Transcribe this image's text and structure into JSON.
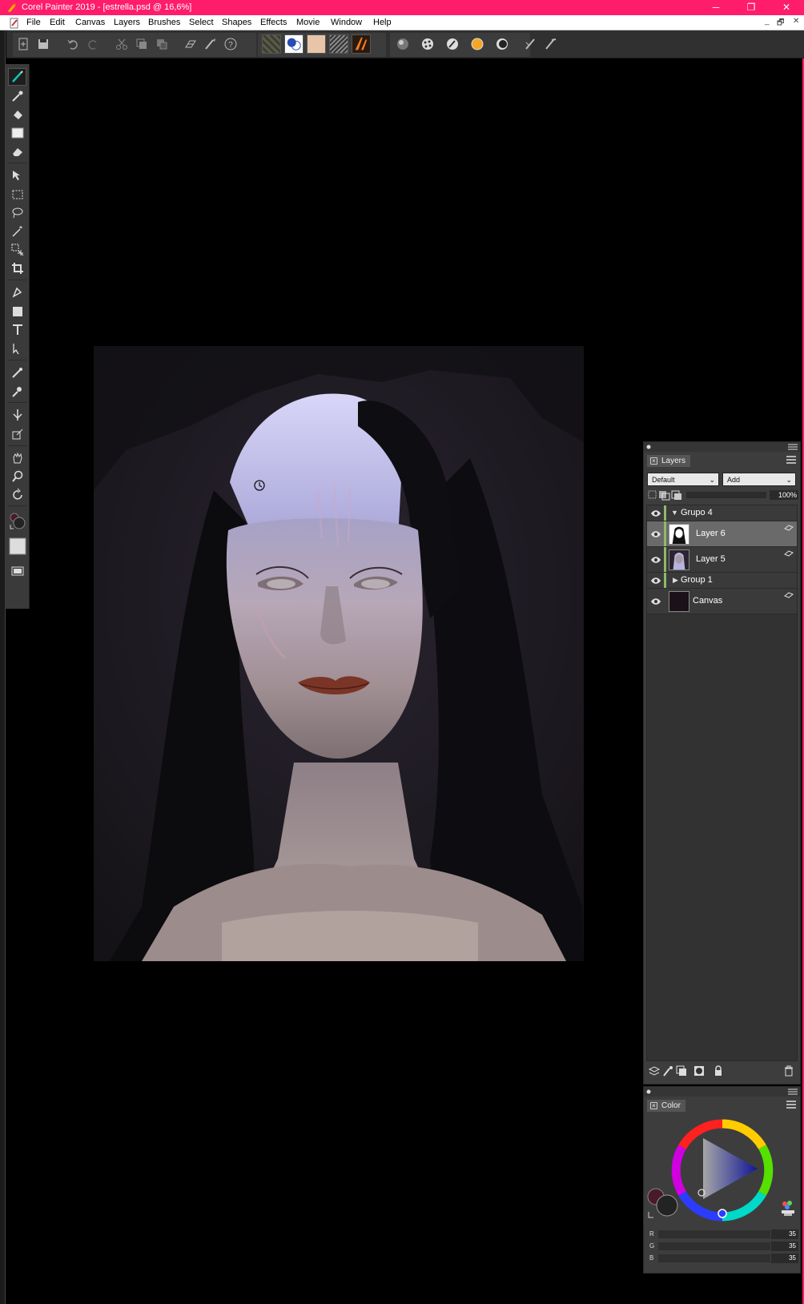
{
  "window": {
    "title": "Corel Painter 2019 - [estrella.psd @ 16,6%]",
    "minimize": "─",
    "restore": "❐",
    "close": "✕"
  },
  "menu": {
    "items": [
      "File",
      "Edit",
      "Canvas",
      "Layers",
      "Brushes",
      "Select",
      "Shapes",
      "Effects",
      "Movie",
      "Window",
      "Help"
    ],
    "mdi": [
      "_",
      "🗗",
      "✕"
    ]
  },
  "layers_panel": {
    "tab_label": "Layers",
    "composite_method": "Default",
    "composite_depth": "Add",
    "opacity": "100%",
    "layers": [
      {
        "name": "Grupo 4",
        "type": "group",
        "expanded": true
      },
      {
        "name": "Layer 6",
        "type": "layer",
        "selected": true
      },
      {
        "name": "Layer 5",
        "type": "layer"
      },
      {
        "name": "Group 1",
        "type": "group",
        "expanded": false
      },
      {
        "name": "Canvas",
        "type": "canvas"
      }
    ]
  },
  "color_panel": {
    "tab_label": "Color",
    "r_label": "R",
    "r_value": "35",
    "g_label": "G",
    "g_value": "35",
    "b_label": "B",
    "b_value": "35"
  },
  "colors": {
    "titlebar": "#ff1c6b",
    "main_color": "#232323",
    "additional_color": "#4a1a28"
  }
}
